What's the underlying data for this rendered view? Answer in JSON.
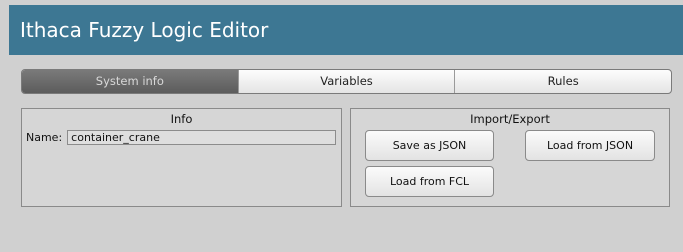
{
  "app": {
    "title": "Ithaca Fuzzy Logic Editor"
  },
  "tabs": [
    {
      "label": "System info",
      "active": true
    },
    {
      "label": "Variables",
      "active": false
    },
    {
      "label": "Rules",
      "active": false
    }
  ],
  "info_panel": {
    "title": "Info",
    "name_label": "Name:",
    "name_value": "container_crane"
  },
  "io_panel": {
    "title": "Import/Export",
    "save_json_label": "Save as JSON",
    "load_json_label": "Load from JSON",
    "load_fcl_label": "Load from FCL"
  },
  "colors": {
    "titlebar": "#3d7793",
    "active_tab": "#666666",
    "background": "#d0d0d0"
  }
}
